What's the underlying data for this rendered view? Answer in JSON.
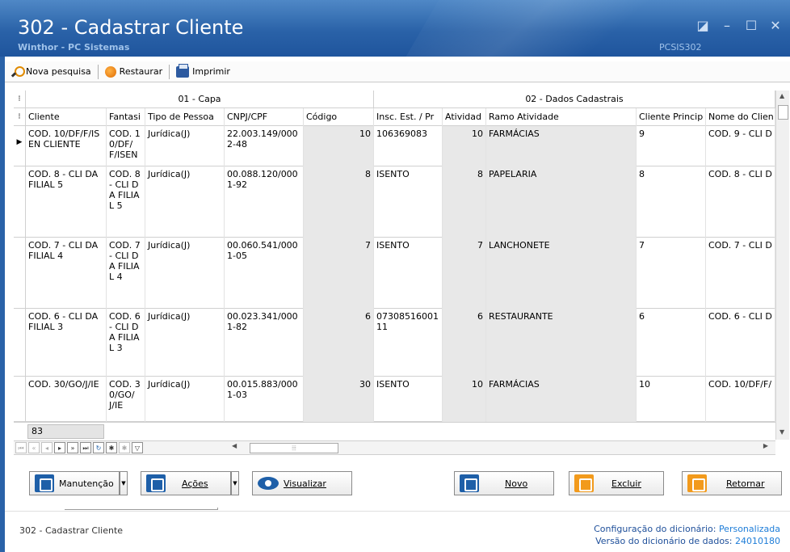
{
  "window": {
    "title": "302 - Cadastrar Cliente",
    "subtitle": "Winthor - PC Sistemas",
    "code": "PCSIS302"
  },
  "toolbar": {
    "nova_pesquisa": "Nova pesquisa",
    "restaurar": "Restaurar",
    "imprimir": "Imprimir"
  },
  "bands": [
    "01 - Capa",
    "02 - Dados Cadastrais"
  ],
  "columns": [
    "Cliente",
    "Fantasi",
    "Tipo de Pessoa",
    "CNPJ/CPF",
    "Código",
    "Insc. Est. / Pr",
    "Atividad",
    "Ramo Atividade",
    "Cliente Princip",
    "Nome do Clien"
  ],
  "rows": [
    [
      "COD. 10/DF/F/ISEN CLIENTE",
      "COD. 10/DF/ F/ISEN",
      "Jurídica(J)",
      "22.003.149/0002-48",
      "10",
      "106369083",
      "10",
      "FARMÁCIAS",
      "9",
      "COD. 9 - CLI D"
    ],
    [
      "COD. 8 - CLI DA FILIAL 5",
      "COD. 8 - CLI DA FILIAL 5",
      "Jurídica(J)",
      "00.088.120/0001-92",
      "8",
      "ISENTO",
      "8",
      "PAPELARIA",
      "8",
      "COD. 8 - CLI D"
    ],
    [
      "COD. 7 - CLI DA FILIAL 4",
      "COD. 7 - CLI DA FILIAL 4",
      "Jurídica(J)",
      "00.060.541/0001-05",
      "7",
      "ISENTO",
      "7",
      "LANCHONETE",
      "7",
      "COD. 7 - CLI D"
    ],
    [
      "COD. 6 - CLI DA FILIAL 3",
      "COD. 6 - CLI DA FILIAL 3",
      "Jurídica(J)",
      "00.023.341/0001-82",
      "6",
      "0730851600111",
      "6",
      "RESTAURANTE",
      "6",
      "COD. 6 - CLI D"
    ],
    [
      "COD. 30/GO/J/IE",
      "COD. 30/GO/ J/IE",
      "Jurídica(J)",
      "00.015.883/0001-03",
      "30",
      "ISENTO",
      "10",
      "FARMÁCIAS",
      "10",
      "COD. 10/DF/F/"
    ]
  ],
  "summary_count": "83",
  "actions": {
    "manutencao": "Manutenção",
    "acoes": "Ações",
    "visualizar": "Visualizar",
    "novo": "Novo",
    "excluir": "Excluir",
    "retornar": "Retornar"
  },
  "status": {
    "left": "302 - Cadastrar Cliente",
    "config_label": "Configuração do dicionário:",
    "config_value": "Personalizada",
    "version_label": "Versão do dicionário de dados:",
    "version_value": "24010180"
  },
  "colors": {
    "titlebar": "#2a62a8",
    "accent_blue": "#1e5fa8",
    "accent_orange": "#f29a1c"
  }
}
